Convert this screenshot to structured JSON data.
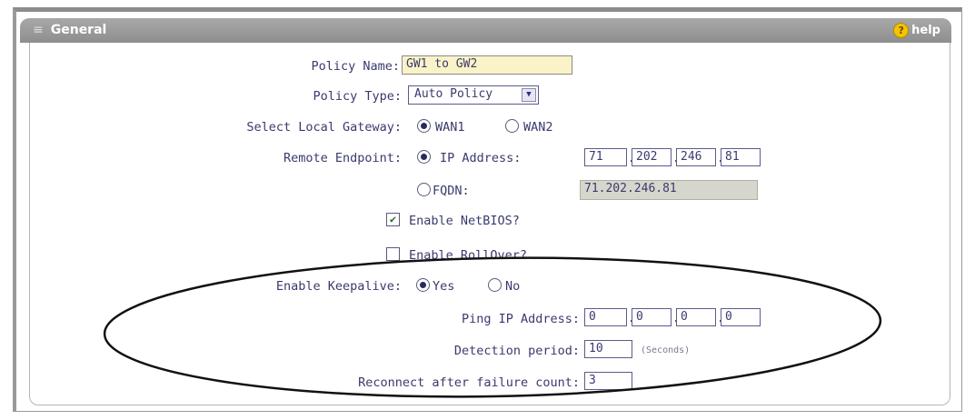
{
  "header": {
    "title": "General",
    "help_label": "help"
  },
  "form": {
    "policy_name": {
      "label": "Policy Name:",
      "value": "GW1 to GW2"
    },
    "policy_type": {
      "label": "Policy Type:",
      "value": "Auto Policy"
    },
    "local_gateway": {
      "label": "Select Local Gateway:",
      "options": [
        "WAN1",
        "WAN2"
      ],
      "selected": "WAN1"
    },
    "remote_endpoint": {
      "label": "Remote Endpoint:",
      "ip_label": "IP Address:",
      "ip": [
        "71",
        "202",
        "246",
        "81"
      ],
      "fqdn_label": "FQDN:",
      "fqdn_value": "71.202.246.81",
      "selected": "IP Address"
    },
    "enable_netbios": {
      "label": "Enable NetBIOS?",
      "checked": true
    },
    "enable_rollover": {
      "label": "Enable RollOver?",
      "checked": false
    },
    "enable_keepalive": {
      "label": "Enable Keepalive:",
      "options": [
        "Yes",
        "No"
      ],
      "selected": "Yes"
    },
    "ping_ip": {
      "label": "Ping IP Address:",
      "octets": [
        "0",
        "0",
        "0",
        "0"
      ]
    },
    "detection_period": {
      "label": "Detection period:",
      "value": "10",
      "unit": "(Seconds)"
    },
    "reconnect": {
      "label": "Reconnect after failure count:",
      "value": "3"
    }
  },
  "icons": {
    "help": "help-icon",
    "check": "checkmark-icon",
    "dropdown": "chevron-down-icon"
  },
  "colors": {
    "header": "#9a9a9a",
    "text": "#3a3a6e",
    "policy_name_bg": "#fbf3c8",
    "fqdn_bg": "#d6d6cc"
  }
}
